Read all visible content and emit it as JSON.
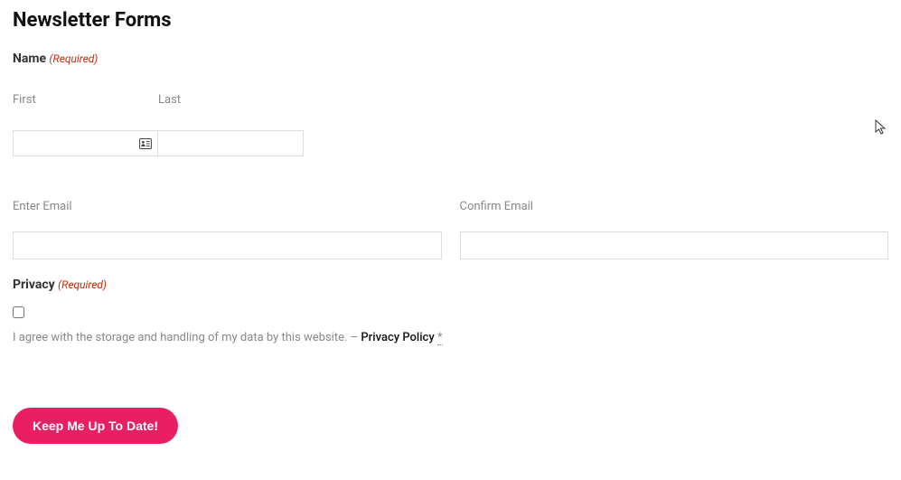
{
  "title": "Newsletter Forms",
  "name": {
    "label": "Name",
    "required_text": "(Required)",
    "first_label": "First",
    "last_label": "Last",
    "first_value": "",
    "last_value": ""
  },
  "email": {
    "enter_label": "Enter Email",
    "confirm_label": "Confirm Email",
    "enter_value": "",
    "confirm_value": ""
  },
  "privacy": {
    "label": "Privacy",
    "required_text": "(Required)",
    "consent_text": "I agree with the storage and handling of my data by this website. –",
    "policy_link_text": "Privacy Policy",
    "asterisk": "*"
  },
  "submit_label": "Keep Me Up To Date!"
}
